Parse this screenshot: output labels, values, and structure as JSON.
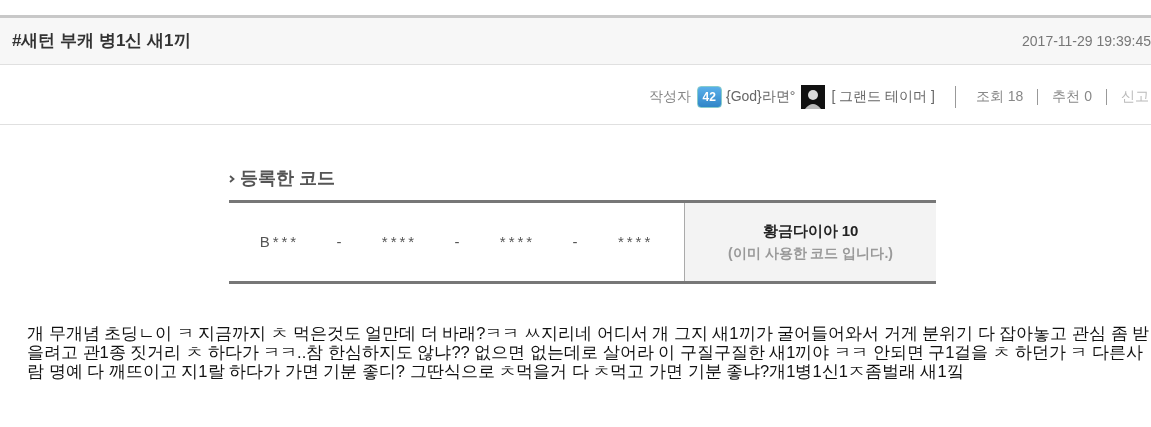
{
  "post": {
    "title": "#새턴 부캐 병1신 새1끼",
    "date": "2017-11-29 19:39:45"
  },
  "meta": {
    "author_label": "작성자",
    "level": "42",
    "nickname": "{God}라면°",
    "guild": "[ 그랜드 테이머 ]",
    "views": "조회 18",
    "recommend": "추천 0",
    "report": "신고"
  },
  "code_section": {
    "heading": "등록한 코드",
    "code_parts": [
      "B***",
      "-",
      "****",
      "-",
      "****",
      "-",
      "****"
    ],
    "reward": "황금다이아 10",
    "status": "(이미 사용한 코드 입니다.)"
  },
  "body_lines": [
    "개 무개념 초딩ㄴ이 ㅋ 지금까지 ㅊ 먹은것도 얼만데 더 바래?ㅋㅋ ㅆ지리네 어디서 개 그지 새1끼가 굴어들어와서 거게 분위기 다 잡아놓고 관심 좀 받",
    "을려고  관1종 짓거리 ㅊ 하다가 ㅋㅋ..참 한심하지도 않냐?? 없으면 없는데로 살어라 이 구질구질한 새1끼야 ㅋㅋ 안되면 구1걸을 ㅊ 하던가 ㅋ 다른사",
    "람 명예 다 깨뜨이고 지1랄 하다가 가면 기분 좋디? 그딴식으로 ㅊ먹을거 다 ㅊ먹고 가면 기분 좋냐?개1병1신1ㅈ좀벌래 새1낔"
  ]
}
